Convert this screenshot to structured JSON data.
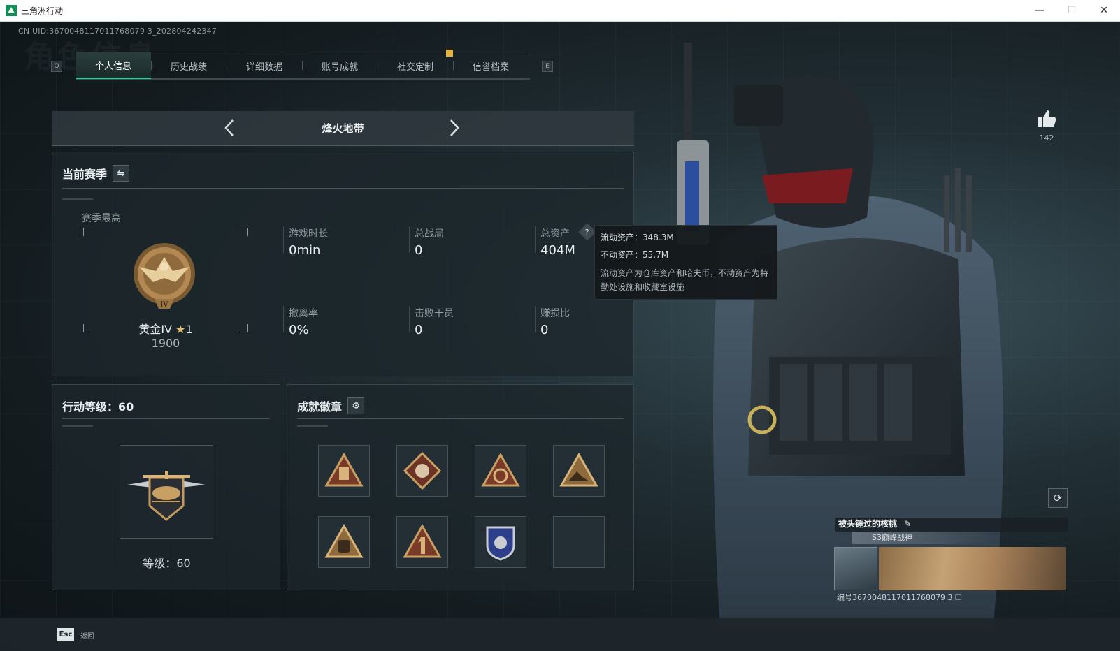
{
  "window": {
    "title": "三角洲行动",
    "minimize": "—",
    "maximize": "☐",
    "close": "✕"
  },
  "uid": "CN UID:3670048117011768079 3_202804242347",
  "watermark": "角色信息",
  "tabs": {
    "left_key": "Q",
    "right_key": "E",
    "items": [
      {
        "label": "个人信息",
        "active": true
      },
      {
        "label": "历史战绩"
      },
      {
        "label": "详细数据"
      },
      {
        "label": "账号成就"
      },
      {
        "label": "社交定制"
      },
      {
        "label": "信誉档案"
      }
    ]
  },
  "mode": {
    "title": "烽火地带"
  },
  "season": {
    "title": "当前赛季",
    "best_label": "赛季最高",
    "rank_name": "黄金IV",
    "rank_stars": "1",
    "rank_points": "1900",
    "stats": [
      {
        "label": "游戏时长",
        "value": "0min"
      },
      {
        "label": "总战局",
        "value": "0"
      },
      {
        "label": "总资产",
        "value": "404M"
      },
      {
        "label": "撤离率",
        "value": "0%"
      },
      {
        "label": "击败干员",
        "value": "0"
      },
      {
        "label": "赚损比",
        "value": "0"
      }
    ]
  },
  "tooltip": {
    "liquid": "流动资产：348.3M",
    "fixed": "不动资产：55.7M",
    "desc": "流动资产为仓库资产和哈夫币，不动资产为特勤处设施和收藏室设施"
  },
  "level": {
    "title": "行动等级：60",
    "label": "等级：60"
  },
  "badges": {
    "title": "成就徽章",
    "items": [
      "triangle-supply-badge",
      "diamond-beast-badge",
      "triangle-target-badge",
      "triangle-mountain-badge",
      "triangle-bag-badge",
      "triangle-number-one-badge",
      "police-shield-badge",
      "empty-slot"
    ]
  },
  "likes": {
    "count": "142"
  },
  "card": {
    "name": "被头锤过的核桃",
    "subtitle": "S3巅峰战神",
    "id": "编号3670048117011768079 3"
  },
  "bottom": {
    "esc_key": "Esc",
    "esc_label": "返回"
  },
  "colors": {
    "accent": "#24d39a",
    "gold": "#c9a064",
    "panel": "#1c262c"
  }
}
